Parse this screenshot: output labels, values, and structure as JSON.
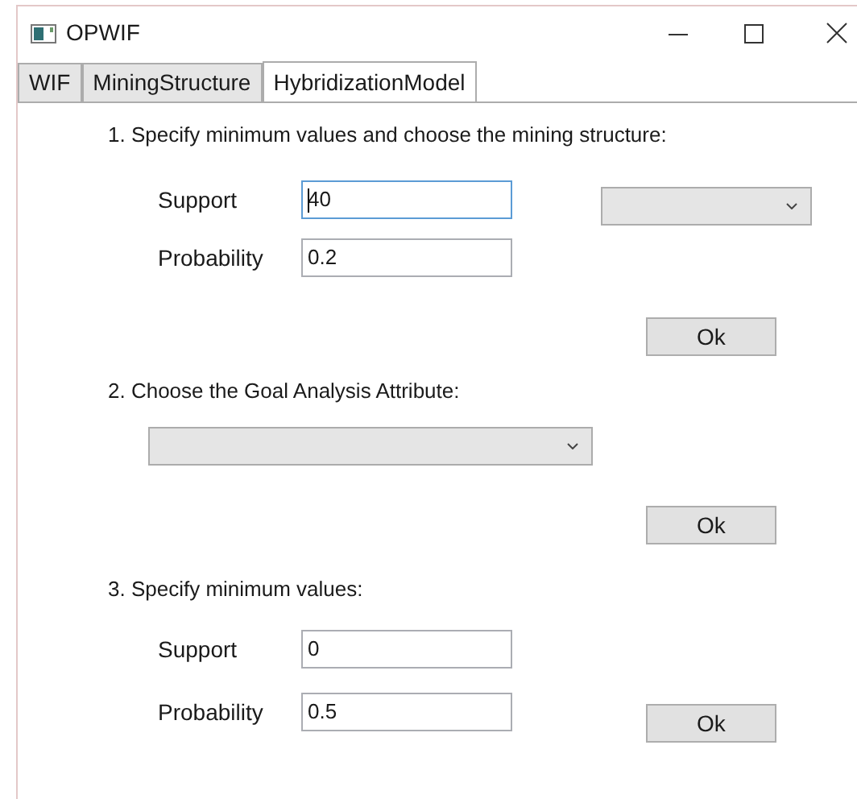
{
  "window": {
    "title": "OPWIF"
  },
  "tabs": [
    {
      "label": "WIF",
      "selected": false
    },
    {
      "label": "MiningStructure",
      "selected": false
    },
    {
      "label": "HybridizationModel",
      "selected": true
    }
  ],
  "sections": [
    {
      "kind": "thresholds-with-structure",
      "heading": "1. Specify minimum values and choose the mining structure:",
      "fields": [
        {
          "label": "Support",
          "value": "40",
          "focused": true
        },
        {
          "label": "Probability",
          "value": "0.2",
          "focused": false
        }
      ],
      "button": "Ok"
    },
    {
      "kind": "goal-attribute",
      "heading": "2. Choose the Goal Analysis Attribute:",
      "button": "Ok"
    },
    {
      "kind": "thresholds",
      "heading": "3. Specify minimum values:",
      "fields": [
        {
          "label": "Support",
          "value": "0",
          "focused": false
        },
        {
          "label": "Probability",
          "value": "0.5",
          "focused": false
        }
      ],
      "button": "Ok"
    }
  ]
}
